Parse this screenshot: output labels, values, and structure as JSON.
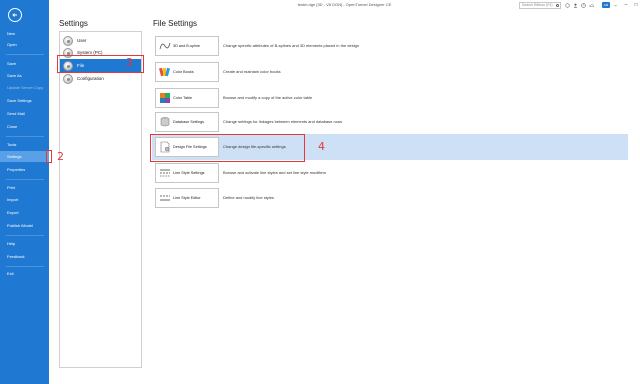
{
  "window": {
    "title": "testm.dgn [3D - V8 DGN] - OpenTunnel Designer CE",
    "search_placeholder": "Search Ribbon (F4)",
    "user_badge": "AM"
  },
  "rail": {
    "items": [
      {
        "label": "New",
        "state": "normal"
      },
      {
        "label": "Open",
        "state": "normal"
      },
      {
        "label": "Save",
        "state": "normal"
      },
      {
        "label": "Save As",
        "state": "normal"
      },
      {
        "label": "Update Server Copy",
        "state": "disabled"
      },
      {
        "label": "Save Settings",
        "state": "normal"
      },
      {
        "label": "Send Mail",
        "state": "normal"
      },
      {
        "label": "Close",
        "state": "normal"
      },
      {
        "label": "Tools",
        "state": "normal"
      },
      {
        "label": "Settings",
        "state": "selected"
      },
      {
        "label": "Properties",
        "state": "normal"
      },
      {
        "label": "Print",
        "state": "normal"
      },
      {
        "label": "Import",
        "state": "normal"
      },
      {
        "label": "Export",
        "state": "normal"
      },
      {
        "label": "Publish iModel",
        "state": "normal"
      },
      {
        "label": "Help",
        "state": "normal"
      },
      {
        "label": "Feedback",
        "state": "normal"
      },
      {
        "label": "Exit",
        "state": "normal"
      }
    ]
  },
  "settings": {
    "heading": "Settings",
    "categories": [
      {
        "label": "User"
      },
      {
        "label": "System (PC)"
      },
      {
        "label": "File",
        "selected": true
      },
      {
        "label": "Configuration"
      }
    ]
  },
  "file_settings": {
    "heading": "File Settings",
    "rows": [
      {
        "button": "3D and B-spline",
        "desc": "Change specific attributes of B-splines and 3D elements placed in the design",
        "icon": "bspline-icon"
      },
      {
        "button": "Color Books",
        "desc": "Create and maintain color books",
        "icon": "color-books-icon"
      },
      {
        "button": "Color Table",
        "desc": "Browse and modify a copy of the active color table",
        "icon": "color-table-icon"
      },
      {
        "button": "Database Settings",
        "desc": "Change settings for linkages between elements and database rows",
        "icon": "database-icon"
      },
      {
        "button": "Design File Settings",
        "desc": "Change design file-specific settings",
        "icon": "design-file-icon",
        "selected": true
      },
      {
        "button": "Line Style Settings",
        "desc": "Browse and activate line styles and set line style modifiers",
        "icon": "line-style-settings-icon"
      },
      {
        "button": "Line Style Editor",
        "desc": "Define and modify line styles",
        "icon": "line-style-editor-icon"
      }
    ]
  },
  "annotations": {
    "n2": "2",
    "n3": "3",
    "n4": "4",
    "color": "#e23a3a"
  },
  "colors": {
    "accent": "#1f78d1",
    "selected_row": "#cde0f5"
  }
}
